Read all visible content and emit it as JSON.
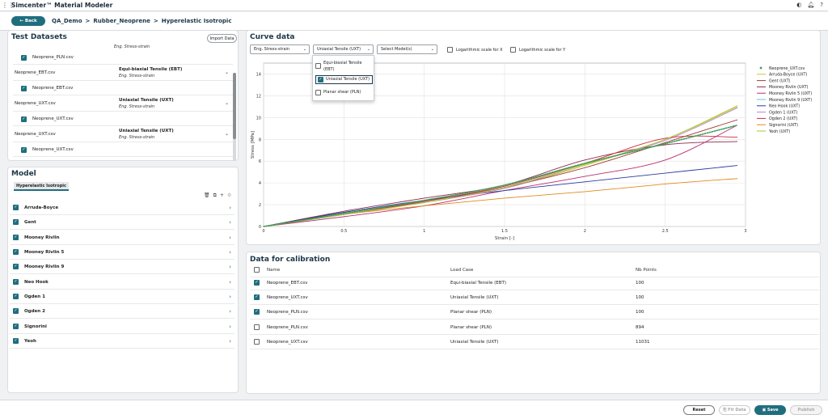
{
  "app": {
    "title": "Simcenter™ Material Modeler"
  },
  "breadcrumb": {
    "back": "Back",
    "parts": [
      "QA_Demo",
      ">",
      "Rubber_Neoprene",
      ">",
      "Hyperelastic Isotropic"
    ]
  },
  "datasets": {
    "title": "Test Datasets",
    "import": "Import Data",
    "rows": [
      {
        "file": "Neoprene_PLN.csv",
        "checked": true
      },
      {
        "file": "Neoprene_EBT.csv",
        "loadcase": "Equi-biaxial Tensile (EBT)",
        "type": "Eng. Stress-strain"
      },
      {
        "file": "Neoprene_EBT.csv",
        "checked": true
      },
      {
        "file": "Neoprene_UXT.csv",
        "loadcase": "Uniaxial Tensile (UXT)",
        "type": "Eng. Stress-strain"
      },
      {
        "file": "Neoprene_UXT.csv",
        "checked": true
      },
      {
        "file": "Neoprene_UXT.csv",
        "loadcase": "Uniaxial Tensile (UXT)",
        "type": "Eng. Stress-strain"
      },
      {
        "file": "Neoprene_UXT.csv",
        "checked": true
      }
    ],
    "top_type": "Eng. Stress-strain"
  },
  "model": {
    "title": "Model",
    "tab": "Hyperelastic Isotropic",
    "items": [
      "Arruda-Boyce",
      "Gent",
      "Mooney Rivlin",
      "Mooney Rivlin 5",
      "Mooney Rivlin 9",
      "Neo Hook",
      "Ogden 1",
      "Ogden 2",
      "Signorini",
      "Yeoh"
    ]
  },
  "curve": {
    "title": "Curve data",
    "sel_type": "Eng. Stress-strain",
    "sel_load": "Uniaxial Tensile (UXT)",
    "sel_model": "Select Model(s)",
    "logx": "Logarithmic scale for X",
    "logy": "Logarithmic scale for Y",
    "menu": [
      {
        "label": "Equi-biaxial Tensile (EBT)",
        "checked": false
      },
      {
        "label": "Uniaxial Tensile (UXT)",
        "checked": true
      },
      {
        "label": "Planar shear (PLN)",
        "checked": false
      }
    ]
  },
  "chart_data": {
    "type": "line",
    "xlabel": "Strain [-]",
    "ylabel": "Stress [MPa]",
    "xlim": [
      0,
      3
    ],
    "ylim": [
      0,
      15
    ],
    "xticks": [
      "0",
      "0.5",
      "1",
      "1.5",
      "2",
      "2.5",
      "3"
    ],
    "yticks": [
      "0",
      "2",
      "4",
      "6",
      "8",
      "10",
      "12",
      "14"
    ],
    "legend_position": "right",
    "grid": true,
    "series": [
      {
        "name": "Neoprene_UXT.csv",
        "color": "#3a9e55",
        "dotted": true,
        "x": [
          0,
          0.5,
          1,
          1.5,
          2,
          2.5,
          2.95
        ],
        "y": [
          0,
          1.2,
          2.4,
          3.8,
          5.8,
          7.6,
          9.3
        ]
      },
      {
        "name": "Arruda-Boyce (UXT)",
        "color": "#c9c52a",
        "x": [
          0,
          0.5,
          1,
          1.5,
          2,
          2.5,
          2.95
        ],
        "y": [
          0,
          1.1,
          2.2,
          3.5,
          5.6,
          8.0,
          11.1
        ]
      },
      {
        "name": "Gent (UXT)",
        "color": "#a33a3a",
        "x": [
          0,
          0.5,
          1,
          1.5,
          2,
          2.5,
          2.95
        ],
        "y": [
          0,
          1.2,
          2.3,
          3.6,
          5.4,
          7.7,
          9.8
        ]
      },
      {
        "name": "Mooney Rivlin (UXT)",
        "color": "#8b2a4a",
        "x": [
          0,
          0.5,
          1,
          1.5,
          2,
          2.5,
          2.95
        ],
        "y": [
          0,
          1.4,
          2.6,
          3.8,
          6.1,
          7.5,
          7.8
        ]
      },
      {
        "name": "Mooney Rivlin 5 (UXT)",
        "color": "#b83070",
        "x": [
          0,
          0.5,
          1,
          1.5,
          2,
          2.5,
          2.95
        ],
        "y": [
          0,
          0.9,
          1.9,
          3.3,
          4.6,
          6.1,
          9.3
        ]
      },
      {
        "name": "Mooney Rivlin 9 (UXT)",
        "color": "#66c4c4",
        "x": [
          0,
          0.5,
          1,
          1.5,
          2,
          2.5,
          2.95
        ],
        "y": [
          0,
          1.2,
          2.4,
          3.8,
          5.8,
          7.6,
          9.3
        ]
      },
      {
        "name": "Neo Hook (UXT)",
        "color": "#2a3aa0",
        "x": [
          0,
          0.5,
          1,
          1.5,
          2,
          2.5,
          2.95
        ],
        "y": [
          0,
          1.3,
          2.4,
          3.3,
          4.1,
          4.9,
          5.6
        ]
      },
      {
        "name": "Ogden 1 (UXT)",
        "color": "#c080c8",
        "x": [
          0,
          0.5,
          1,
          1.5,
          2,
          2.5,
          2.95
        ],
        "y": [
          0,
          1.1,
          2.2,
          3.5,
          5.7,
          7.9,
          10.9
        ]
      },
      {
        "name": "Ogden 2 (UXT)",
        "color": "#d02a40",
        "x": [
          0,
          0.5,
          1,
          1.5,
          2,
          2.5,
          2.95
        ],
        "y": [
          0,
          1.1,
          2.3,
          3.7,
          5.8,
          8.1,
          8.2
        ]
      },
      {
        "name": "Signorini (UXT)",
        "color": "#e08a20",
        "x": [
          0,
          0.5,
          1,
          1.5,
          2,
          2.5,
          2.95
        ],
        "y": [
          0,
          1.1,
          1.9,
          2.6,
          3.2,
          3.9,
          4.4
        ]
      },
      {
        "name": "Yeoh (UXT)",
        "color": "#9acc30",
        "x": [
          0,
          0.5,
          1,
          1.5,
          2,
          2.5,
          2.95
        ],
        "y": [
          0,
          1.1,
          2.2,
          3.6,
          5.7,
          8.0,
          11.0
        ]
      }
    ]
  },
  "calib": {
    "title": "Data for calibration",
    "headers": [
      "Name",
      "Load Case",
      "Nb Points"
    ],
    "rows": [
      {
        "name": "Neoprene_EBT.csv",
        "lc": "Equi-biaxial Tensile (EBT)",
        "n": "100",
        "checked": true
      },
      {
        "name": "Neoprene_UXT.csv",
        "lc": "Uniaxial Tensile (UXT)",
        "n": "100",
        "checked": true
      },
      {
        "name": "Neoprene_PLN.csv",
        "lc": "Planar shear (PLN)",
        "n": "100",
        "checked": true
      },
      {
        "name": "Neoprene_PLN.csv",
        "lc": "Planar shear (PLN)",
        "n": "894",
        "checked": false
      },
      {
        "name": "Neoprene_UXT.csv",
        "lc": "Uniaxial Tensile (UXT)",
        "n": "11031",
        "checked": false
      }
    ]
  },
  "footer": {
    "reset": "Reset",
    "fit": "Fit Data",
    "save": "Save",
    "publish": "Publish"
  },
  "colors": {
    "accent": "#1f6e7e"
  }
}
